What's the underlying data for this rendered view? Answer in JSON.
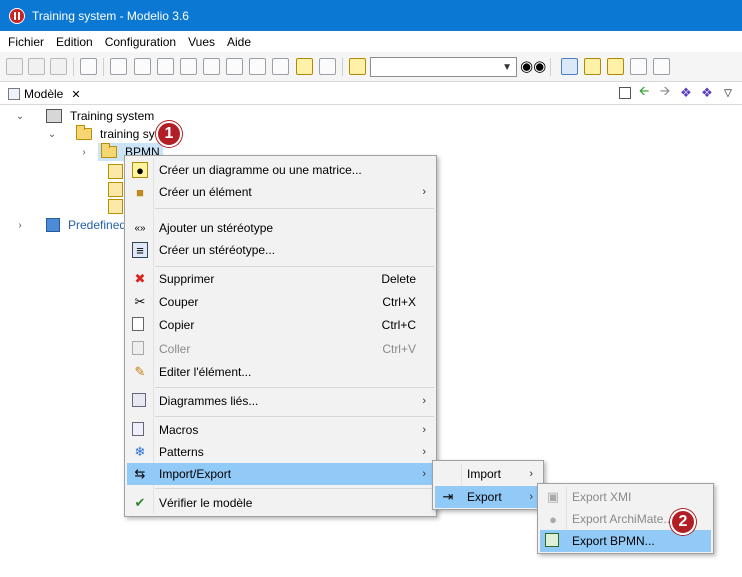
{
  "window": {
    "title": "Training system - Modelio 3.6"
  },
  "menubar": [
    "Fichier",
    "Edition",
    "Configuration",
    "Vues",
    "Aide"
  ],
  "panel": {
    "tab_label": "Modèle"
  },
  "tree": {
    "root": "Training system",
    "child": "training sy",
    "bpmn": "BPMN",
    "predefined": "Predefined"
  },
  "markers": {
    "one": "1",
    "two": "2"
  },
  "context_menu": {
    "items": [
      {
        "label": "Créer un diagramme ou une matrice..."
      },
      {
        "label": "Créer un élément"
      },
      {
        "label": "Ajouter un stéréotype"
      },
      {
        "label": "Créer un stéréotype..."
      },
      {
        "label": "Supprimer",
        "shortcut": "Delete"
      },
      {
        "label": "Couper",
        "shortcut": "Ctrl+X"
      },
      {
        "label": "Copier",
        "shortcut": "Ctrl+C"
      },
      {
        "label": "Coller",
        "shortcut": "Ctrl+V"
      },
      {
        "label": "Editer l'élément..."
      },
      {
        "label": "Diagrammes liés..."
      },
      {
        "label": "Macros"
      },
      {
        "label": "Patterns"
      },
      {
        "label": "Import/Export"
      },
      {
        "label": "Vérifier le modèle"
      }
    ]
  },
  "submenu_ie": {
    "import": "Import",
    "export": "Export"
  },
  "submenu_export": {
    "xmi": "Export XMI",
    "archimate": "Export ArchiMate...",
    "bpmn": "Export BPMN..."
  },
  "colors": {
    "titlebar": "#0b78d4",
    "hover": "#91c9f7",
    "marker": "#b11e25"
  }
}
